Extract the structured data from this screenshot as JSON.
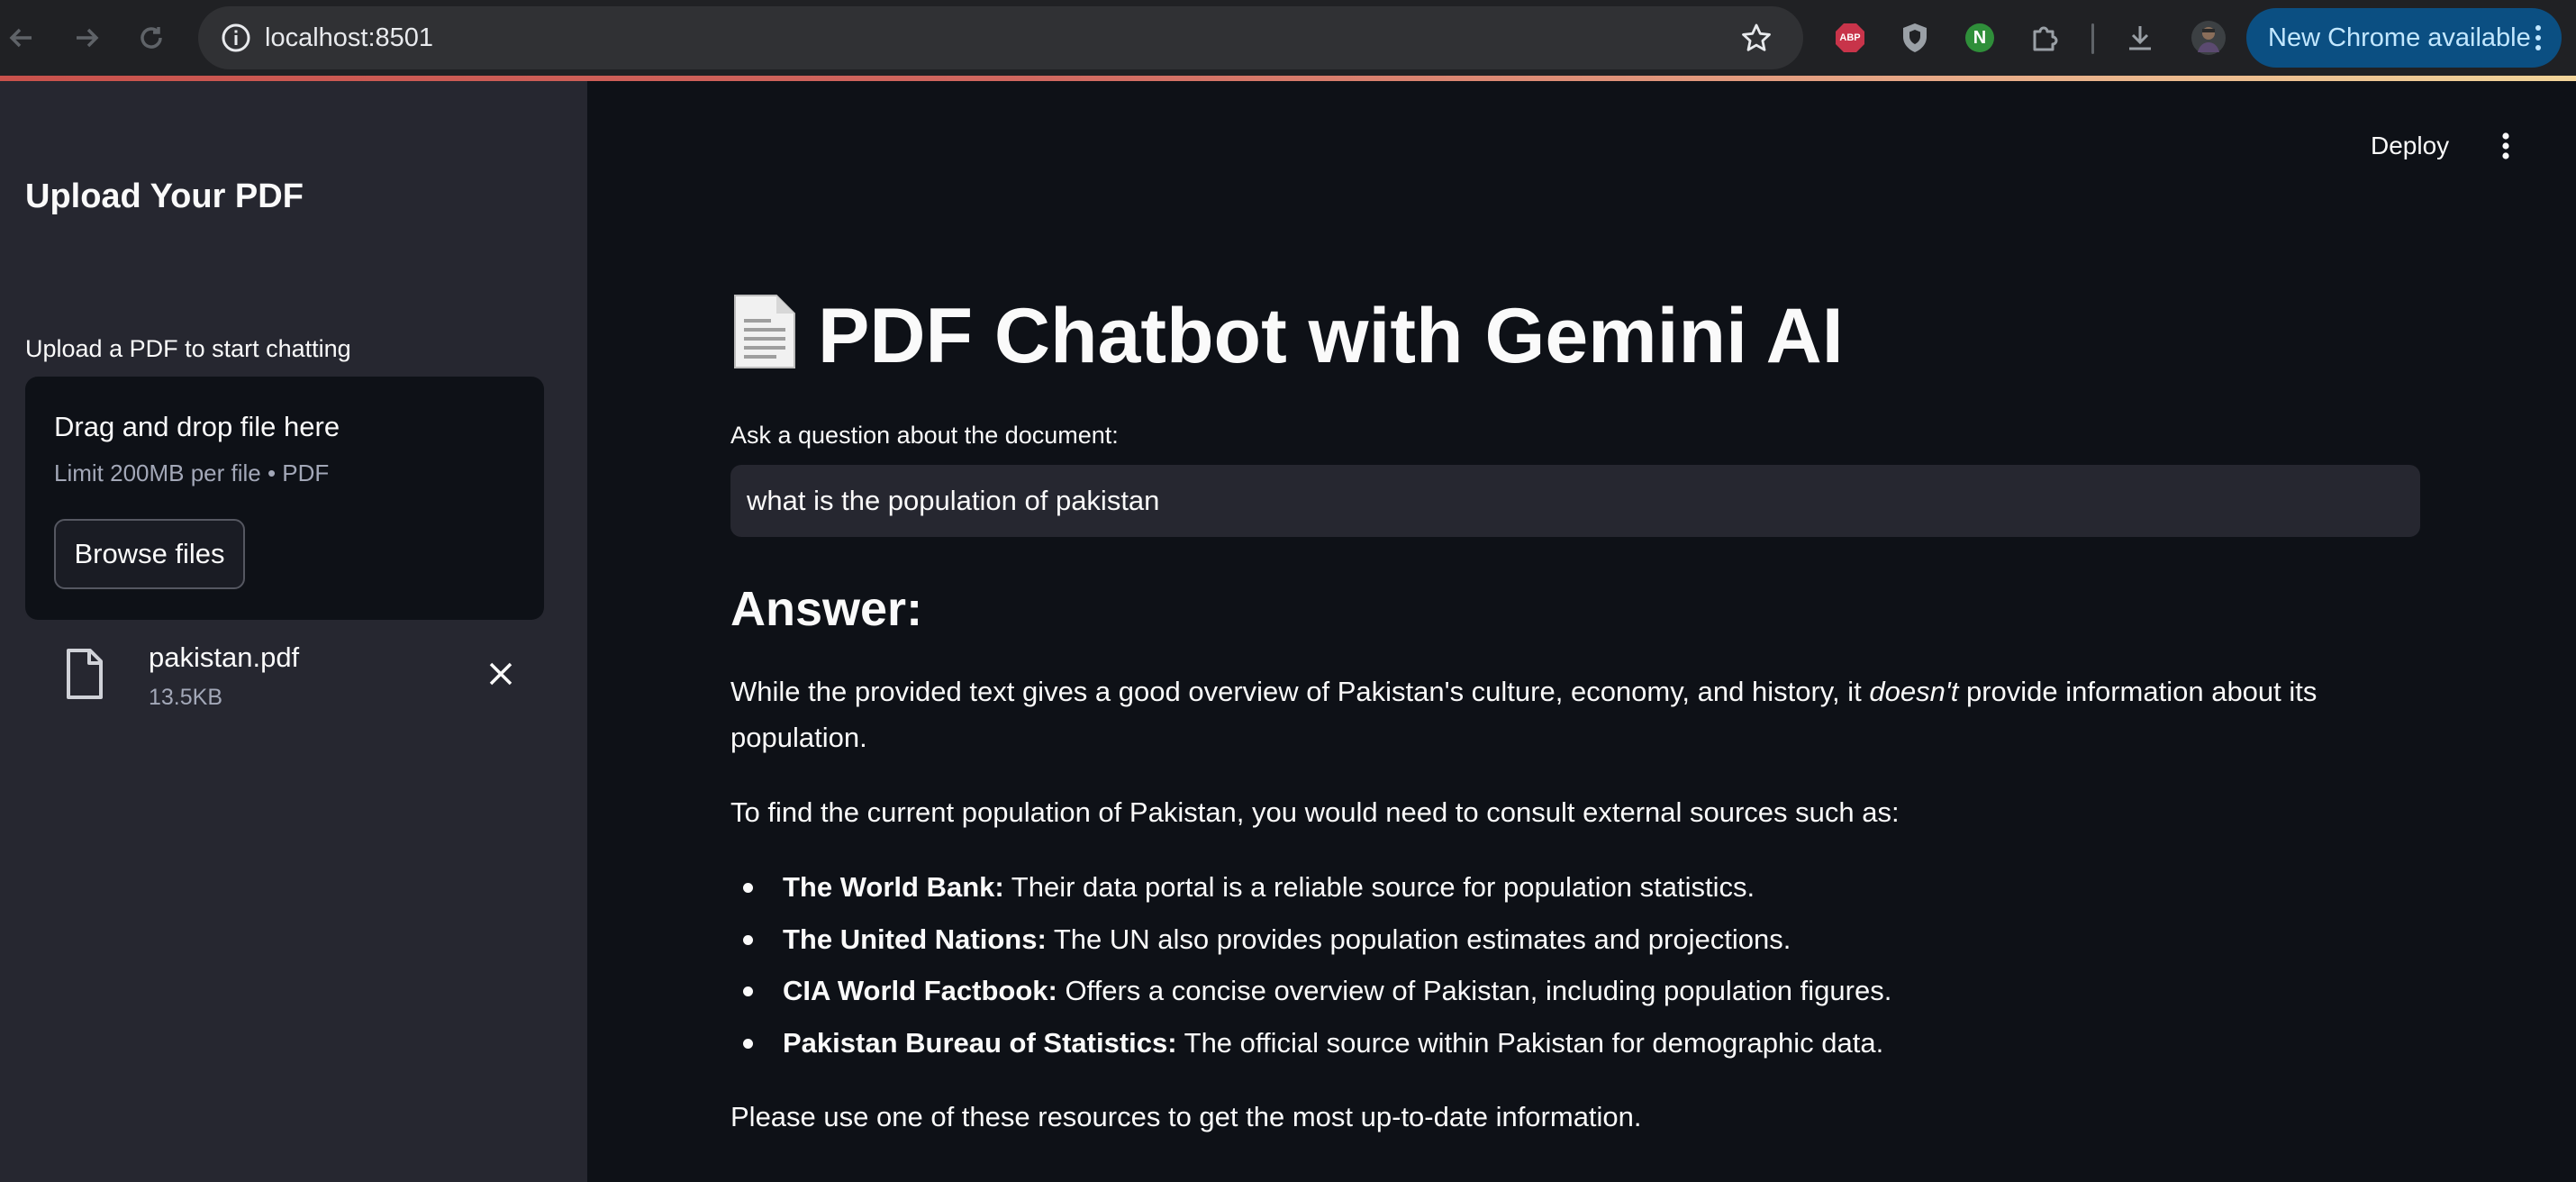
{
  "browser": {
    "url": "localhost:8501",
    "update_label": "New Chrome available",
    "extensions": [
      "abp-icon",
      "shield-extension-icon",
      "green-n-extension-icon",
      "puzzle-icon"
    ],
    "abp_text": "ABP",
    "n_text": "N"
  },
  "sidebar": {
    "title": "Upload Your PDF",
    "uploader_label": "Upload a PDF to start chatting",
    "dropzone_title": "Drag and drop file here",
    "dropzone_limit": "Limit 200MB per file • PDF",
    "browse_label": "Browse files",
    "file": {
      "name": "pakistan.pdf",
      "size": "13.5KB"
    }
  },
  "header": {
    "deploy_label": "Deploy"
  },
  "main": {
    "title": "PDF Chatbot with Gemini AI",
    "title_icon": "page-facing-up-icon",
    "input_label": "Ask a question about the document:",
    "input_value": "what is the population of pakistan",
    "answer_heading": "Answer:",
    "p1_a": "While the provided text gives a good overview of Pakistan's culture, economy, and history, it ",
    "p1_em": "doesn't",
    "p1_b": " provide information about its population.",
    "p2": "To find the current population of Pakistan, you would need to consult external sources such as:",
    "sources": [
      {
        "name": "The World Bank:",
        "desc": " Their data portal is a reliable source for population statistics."
      },
      {
        "name": "The United Nations:",
        "desc": " The UN also provides population estimates and projections."
      },
      {
        "name": "CIA World Factbook:",
        "desc": " Offers a concise overview of Pakistan, including population figures."
      },
      {
        "name": "Pakistan Bureau of Statistics:",
        "desc": " The official source within Pakistan for demographic data."
      }
    ],
    "p3": "Please use one of these resources to get the most up-to-date information."
  },
  "colors": {
    "app_bg": "#0e1117",
    "sidebar_bg": "#262730",
    "text": "#fafafa",
    "muted": "#a3a8b8",
    "chrome_bg": "#202124",
    "update_pill": "#0b4f82"
  }
}
